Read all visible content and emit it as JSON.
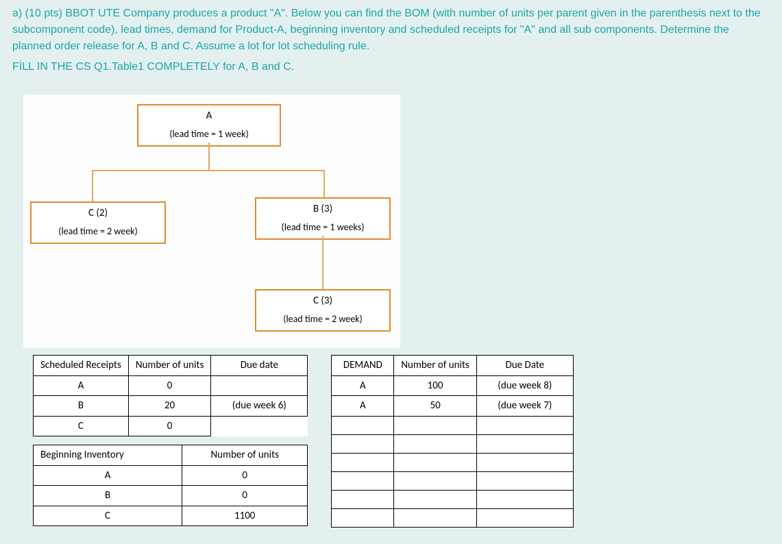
{
  "question": {
    "intro": "a) (10 pts) BBOT UTE Company produces a product \"A\". Below you can find the BOM (with number of units per parent given in the parenthesis next to the subcomponent code), lead times, demand for Product-A, beginning inventory and scheduled receipts for \"A\" and all sub components. Determine the planned order release for A, B and C.  Assume a lot for lot scheduling rule.",
    "fill": "FİLL IN THE CS Q1.Table1 COMPLETELY for A, B and C."
  },
  "bom": {
    "A": {
      "title": "A",
      "lead": "(lead time = 1 week)"
    },
    "C2": {
      "title": "C (2)",
      "lead": "(lead time = 2 week)"
    },
    "B3": {
      "title": "B (3)",
      "lead": "(lead time = 1 weeks)"
    },
    "C3": {
      "title": "C (3)",
      "lead": "(lead time = 2 week)"
    }
  },
  "scheduled": {
    "header": {
      "c1": "Scheduled Receipts",
      "c2": "Number of units",
      "c3": "Due date"
    },
    "rows": [
      {
        "item": "A",
        "units": "0",
        "due": ""
      },
      {
        "item": "B",
        "units": "20",
        "due": "(due week 6)"
      },
      {
        "item": "C",
        "units": "0",
        "due": ""
      }
    ]
  },
  "inventory": {
    "header": {
      "c1": "Beginning Inventory",
      "c2": "Number of units"
    },
    "rows": [
      {
        "item": "A",
        "units": "0"
      },
      {
        "item": "B",
        "units": "0"
      },
      {
        "item": "C",
        "units": "1100"
      }
    ]
  },
  "demand": {
    "header": {
      "c1": "DEMAND",
      "c2": "Number of units",
      "c3": "Due Date"
    },
    "rows": [
      {
        "item": "A",
        "units": "100",
        "due": "(due week 8)"
      },
      {
        "item": "A",
        "units": "50",
        "due": "(due week 7)"
      }
    ]
  }
}
